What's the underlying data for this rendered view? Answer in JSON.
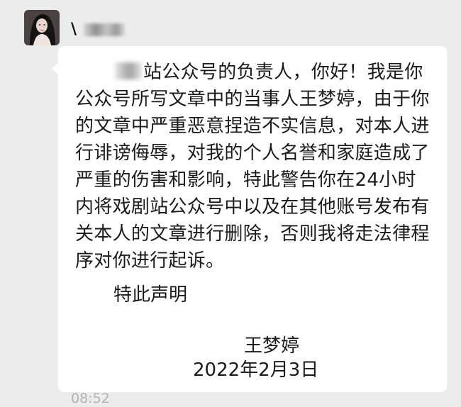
{
  "chat": {
    "sender": {
      "name_visible": "\\",
      "avatar_icon": "profile-photo"
    },
    "message": {
      "lines": [
        "站公众号的负责人，你好！我是你",
        "公众号所写文章中的当事人王梦婷，由于你",
        "的文章中严重恶意捏造不实信息，对本人进",
        "行诽谤侮辱，对我的个人名誉和家庭造成了",
        "严重的伤害和影响，特此警告你在24小时",
        "内将戏剧站公众号中以及在其他账号发布有",
        "关本人的文章进行删除，否则我将走法律程",
        "序对你进行起诉。"
      ],
      "declaration": "特此声明",
      "signature_name": "王梦婷",
      "signature_date": "2022年2月3日"
    },
    "timestamp": "08:52",
    "colors": {
      "background": "#ececec",
      "bubble": "#ffffff",
      "text": "#1a1a1a",
      "timestamp": "#b4b4b4"
    }
  }
}
